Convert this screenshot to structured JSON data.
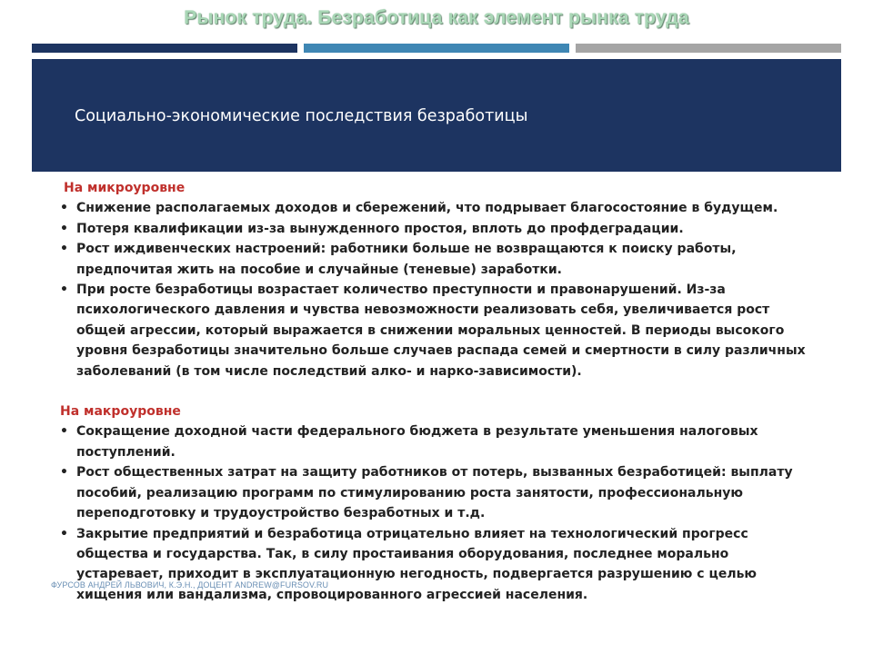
{
  "slide": {
    "title": "Рынок труда. Безработица как элемент рынка труда",
    "heading": "Социально-экономические последствия безработицы"
  },
  "micro": {
    "heading": "На микроуровне",
    "items": [
      "Снижение располагаемых доходов и сбережений, что подрывает благосостояние в будущем.",
      "Потеря квалификации из-за вынужденного простоя, вплоть до профдеградации.",
      "Рост иждивенческих настроений: работники больше не возвращаются к поиску работы, предпочитая жить на пособие и случайные (теневые) заработки.",
      "При росте безработицы возрастает количество преступности и правонарушений. Из-за психологического давления и чувства невозможности реализовать себя, увеличивается рост общей агрессии, который выражается в снижении моральных ценностей. В периоды высокого уровня безработицы значительно больше случаев распада семей и смертности в силу различных заболеваний (в том числе последствий алко- и нарко-зависимости)."
    ]
  },
  "macro": {
    "heading": "На макроуровне",
    "items": [
      "Сокращение доходной части федерального бюджета в результате уменьшения налоговых поступлений.",
      "Рост общественных затрат на защиту работников от потерь, вызванных безработицей: выплату пособий, реализацию программ по стимулированию роста занятости, профессиональную переподготовку и трудоустройство безработных и т.д.",
      "Закрытие предприятий и безработица отрицательно влияет на технологический прогресс общества и государства. Так, в силу простаивания оборудования, последнее морально устаревает, приходит в эксплуатационную негодность, подвергается разрушению с целью хищения или вандализма, спровоцированного агрессией населения."
    ]
  },
  "footer": {
    "text": "ФУРСОВ АНДРЕЙ ЛЬВОВИЧ, К.Э.Н., ДОЦЕНТ ANDREW@FURSOV.RU"
  },
  "colors": {
    "band": "#1d3461",
    "accent_blue": "#3f87b4",
    "accent_gray": "#a5a5a5",
    "section_heading": "#c0302c",
    "title": "#a9d7b6",
    "footer": "#6a8fb4"
  }
}
